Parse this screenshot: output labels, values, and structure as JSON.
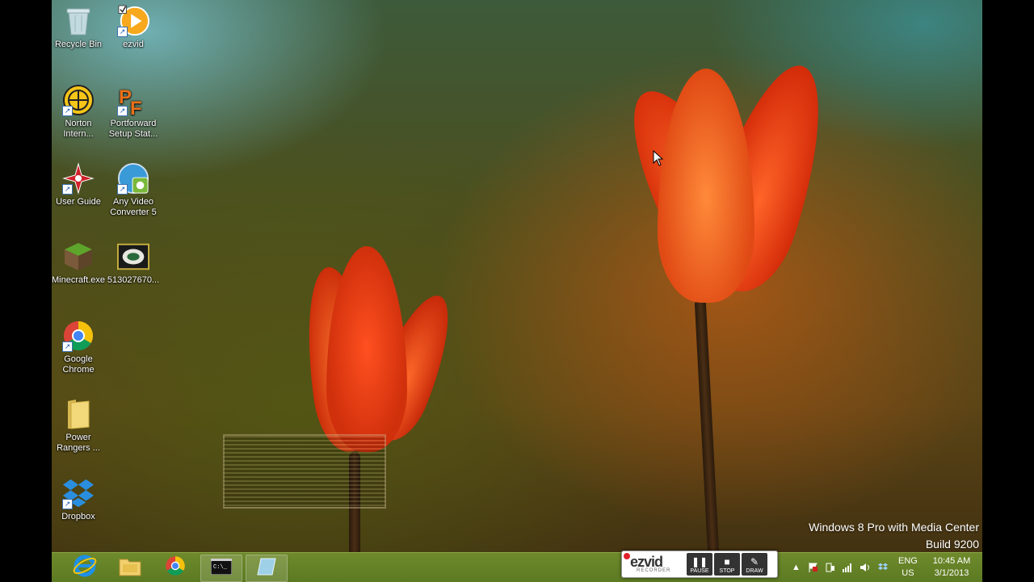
{
  "desktop_icons": [
    {
      "label": "Recycle Bin",
      "icon": "recycle-bin-icon"
    },
    {
      "label": "ezvid",
      "icon": "ezvid-icon"
    },
    {
      "label": "Norton Intern...",
      "icon": "norton-icon"
    },
    {
      "label": "Portforward Setup Stat...",
      "icon": "portforward-icon"
    },
    {
      "label": "User Guide",
      "icon": "user-guide-icon"
    },
    {
      "label": "Any Video Converter 5",
      "icon": "video-converter-icon"
    },
    {
      "label": "Minecraft.exe",
      "icon": "minecraft-icon"
    },
    {
      "label": "513027670...",
      "icon": "image-file-icon"
    },
    {
      "label": "Google Chrome",
      "icon": "chrome-icon"
    },
    {
      "label": "Power Rangers ...",
      "icon": "folder-icon"
    },
    {
      "label": "Dropbox",
      "icon": "dropbox-icon"
    }
  ],
  "watermark": {
    "line1": "Windows 8 Pro with Media Center",
    "line2": "Build 9200"
  },
  "taskbar": {
    "pinned": [
      {
        "name": "internet-explorer",
        "icon": "ie-icon"
      },
      {
        "name": "file-explorer",
        "icon": "file-explorer-icon"
      },
      {
        "name": "chrome",
        "icon": "chrome-icon"
      },
      {
        "name": "command-prompt",
        "icon": "cmd-icon"
      },
      {
        "name": "ezvid-window",
        "icon": "ezvid-window-icon"
      }
    ],
    "ezvid_recorder": {
      "logo": "ezvid",
      "sub": "RECORDER",
      "pause": "PAUSE",
      "stop": "STOP",
      "draw": "DRAW"
    },
    "language": {
      "line1": "ENG",
      "line2": "US"
    },
    "clock": {
      "time": "10:45 AM",
      "date": "3/1/2013"
    }
  },
  "colors": {
    "taskbar": "#6e8a2c",
    "tulip": "#e8481a"
  }
}
